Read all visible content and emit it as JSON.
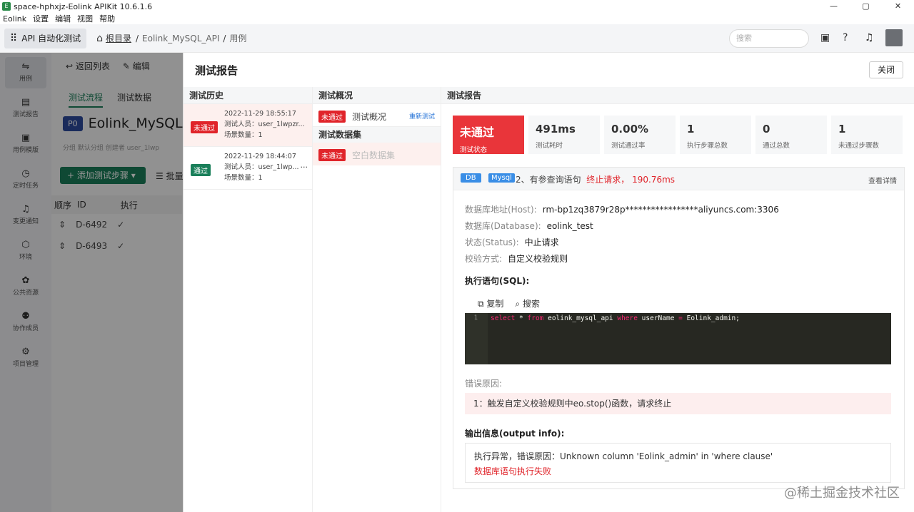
{
  "window": {
    "title": "space-hphxjz-Eolink APIKit 10.6.1.6",
    "minimize": "—",
    "maximize": "▢",
    "close": "✕"
  },
  "menubar": [
    "Eolink",
    "设置",
    "编辑",
    "视图",
    "帮助"
  ],
  "topbar": {
    "app_name": "API 自动化测试",
    "breadcrumb": {
      "root": "根目录",
      "sep1": "/",
      "project": "Eolink_MySQL_API",
      "sep2": "/",
      "current": "用例"
    },
    "search_placeholder": "搜索"
  },
  "sidebar": [
    {
      "icon": "⇋",
      "label": "用例"
    },
    {
      "icon": "▤",
      "label": "测试报告"
    },
    {
      "icon": "▣",
      "label": "用例模版"
    },
    {
      "icon": "◷",
      "label": "定时任务"
    },
    {
      "icon": "♫",
      "label": "变更通知"
    },
    {
      "icon": "⬡",
      "label": "环境"
    },
    {
      "icon": "✿",
      "label": "公共资源"
    },
    {
      "icon": "⚉",
      "label": "协作成员"
    },
    {
      "icon": "⚙",
      "label": "项目管理"
    }
  ],
  "main": {
    "back": "返回列表",
    "edit": "编辑",
    "tabs": [
      "测试流程",
      "测试数据"
    ],
    "tag": "P0",
    "name": "Eolink_MySQL",
    "meta": "分组  默认分组        创建者  user_1lwp",
    "add_step": "添加测试步骤",
    "batch": "批量",
    "table_head": {
      "order": "顺序",
      "id": "ID",
      "exec": "执行"
    },
    "rows": [
      {
        "id": "D-6492"
      },
      {
        "id": "D-6493"
      }
    ]
  },
  "drawer": {
    "title": "测试报告",
    "close": "关闭",
    "history": {
      "header": "测试历史",
      "items": [
        {
          "status": "未通过",
          "status_type": "fail",
          "time": "2022-11-29 18:55:17",
          "tester": "测试人员：user_1lwpzr...",
          "count": "场景数量：1"
        },
        {
          "status": "通过",
          "status_type": "pass",
          "time": "2022-11-29 18:44:07",
          "tester": "测试人员：user_1lwp...",
          "count": "场景数量：1"
        }
      ]
    },
    "overview": {
      "header": "测试概况",
      "row": {
        "status": "未通过",
        "label": "测试概况",
        "rerun": "重新测试"
      },
      "dataset_header": "测试数据集",
      "dataset": {
        "status": "未通过",
        "label": "空白数据集"
      }
    },
    "report": {
      "header": "测试报告",
      "stats": [
        {
          "value": "未通过",
          "label": "测试状态"
        },
        {
          "value": "491ms",
          "label": "测试耗时"
        },
        {
          "value": "0.00%",
          "label": "测试通过率"
        },
        {
          "value": "1",
          "label": "执行步骤总数"
        },
        {
          "value": "0",
          "label": "通过总数"
        },
        {
          "value": "1",
          "label": "未通过步骤数"
        }
      ],
      "step": {
        "db": "DB",
        "mysql": "Mysql",
        "title": "2、有参查询语句",
        "state": "终止请求，",
        "time": "190.76ms",
        "more": "查看详情"
      },
      "host": {
        "k": "数据库地址(Host):",
        "v": "rm-bp1zq3879r28p*****************aliyuncs.com:3306"
      },
      "database": {
        "k": "数据库(Database):",
        "v": "eolink_test"
      },
      "status": {
        "k": "状态(Status):",
        "v": "中止请求"
      },
      "check": {
        "k": "校验方式:",
        "v": "自定义校验规则"
      },
      "sql_title": "执行语句(SQL):",
      "copy": "复制",
      "search": "搜索",
      "line_no": "1",
      "sql": {
        "select": "select",
        "star": " * ",
        "from": "from",
        "table": " eolink_mysql_api ",
        "where": "where",
        "col": " userName ",
        "eq": "=",
        "val": " Eolink_admin;"
      },
      "error_title": "错误原因:",
      "error": "1：触发自定义校验规则中eo.stop()函数，请求终止",
      "output_title": "输出信息(output info):",
      "output_line1": "执行异常，错误原因：Unknown column 'Eolink_admin' in 'where clause'",
      "output_line2": "数据库语句执行失败"
    }
  },
  "watermark": "@稀土掘金技术社区"
}
